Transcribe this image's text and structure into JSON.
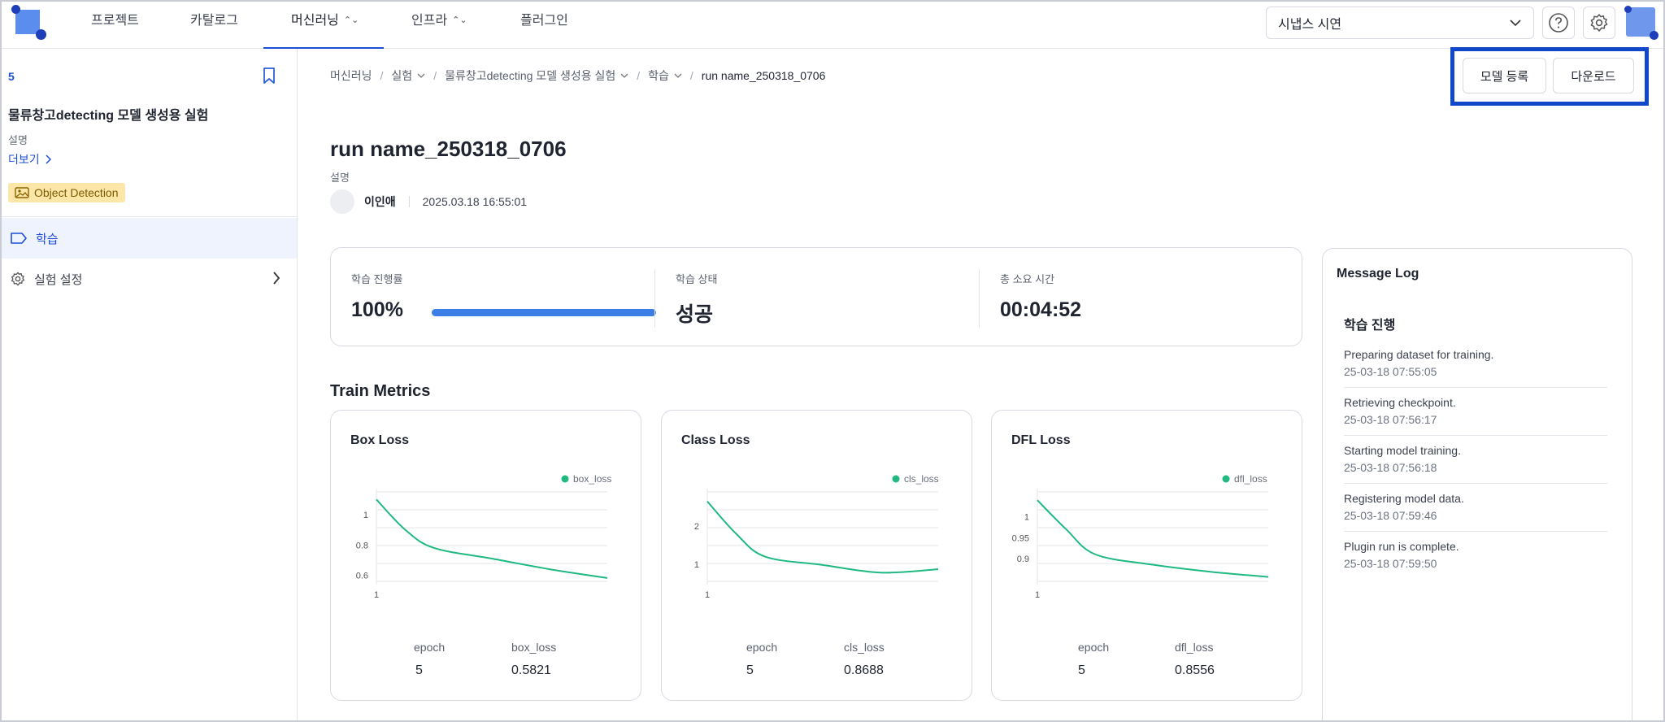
{
  "nav": {
    "items": [
      {
        "label": "프로젝트",
        "has_chevron": false,
        "active": false
      },
      {
        "label": "카탈로그",
        "has_chevron": false,
        "active": false
      },
      {
        "label": "머신러닝",
        "has_chevron": true,
        "active": true
      },
      {
        "label": "인프라",
        "has_chevron": true,
        "active": false
      },
      {
        "label": "플러그인",
        "has_chevron": false,
        "active": false
      }
    ],
    "workspace": "시냅스 시연",
    "accent_color": "#1d4ed8"
  },
  "sidebar": {
    "count": "5",
    "experiment_title": "물류창고detecting 모델 생성용 실험",
    "description_label": "설명",
    "more_label": "더보기",
    "tag": "Object Detection",
    "menu": [
      {
        "label": "학습",
        "icon": "tag-icon",
        "active": true
      },
      {
        "label": "실험 설정",
        "icon": "gear-icon",
        "active": false
      }
    ]
  },
  "breadcrumb": [
    {
      "label": "머신러닝",
      "dropdown": false
    },
    {
      "label": "실험",
      "dropdown": true
    },
    {
      "label": "물류창고detecting 모델 생성용 실험",
      "dropdown": true
    },
    {
      "label": "학습",
      "dropdown": true
    },
    {
      "label": "run name_250318_0706",
      "dropdown": false
    }
  ],
  "actions": {
    "register_model": "모델 등록",
    "download": "다운로드"
  },
  "run": {
    "title": "run name_250318_0706",
    "description_label": "설명",
    "user": "이인애",
    "date": "2025.03.18 16:55:01"
  },
  "stats": {
    "progress_label": "학습 진행률",
    "progress_value": "100%",
    "progress_fraction": 1.0,
    "status_label": "학습 상태",
    "status_value": "성공",
    "duration_label": "총 소요 시간",
    "duration_value": "00:04:52"
  },
  "metrics_section_title": "Train Metrics",
  "metrics": [
    {
      "title": "Box Loss",
      "legend": "box_loss",
      "field1_label": "epoch",
      "field1_value": "5",
      "field2_label": "box_loss",
      "field2_value": "0.5821"
    },
    {
      "title": "Class Loss",
      "legend": "cls_loss",
      "field1_label": "epoch",
      "field1_value": "5",
      "field2_label": "cls_loss",
      "field2_value": "0.8688"
    },
    {
      "title": "DFL Loss",
      "legend": "dfl_loss",
      "field1_label": "epoch",
      "field1_value": "5",
      "field2_label": "dfl_loss",
      "field2_value": "0.8556"
    }
  ],
  "chart_data": [
    {
      "type": "line",
      "series": [
        {
          "name": "box_loss",
          "x": [
            1,
            1.5,
            2,
            3,
            4,
            5
          ],
          "y": [
            1.1,
            0.9,
            0.78,
            0.71,
            0.64,
            0.582
          ]
        }
      ],
      "yticks": [
        0.6,
        0.8,
        1
      ],
      "xticks": [
        1
      ],
      "ylim": [
        0.56,
        1.15
      ],
      "color": "#1fb981"
    },
    {
      "type": "line",
      "series": [
        {
          "name": "cls_loss",
          "x": [
            1,
            1.5,
            2,
            3,
            4,
            5
          ],
          "y": [
            2.65,
            1.8,
            1.2,
            0.98,
            0.78,
            0.869
          ]
        }
      ],
      "yticks": [
        1,
        2
      ],
      "xticks": [
        1
      ],
      "ylim": [
        0.55,
        2.9
      ],
      "color": "#1fb981"
    },
    {
      "type": "line",
      "series": [
        {
          "name": "dfl_loss",
          "x": [
            1,
            1.5,
            2,
            3,
            4,
            5
          ],
          "y": [
            1.04,
            0.97,
            0.91,
            0.885,
            0.868,
            0.8556
          ]
        }
      ],
      "yticks": [
        0.9,
        0.95,
        1
      ],
      "xticks": [
        1
      ],
      "ylim": [
        0.845,
        1.06
      ],
      "color": "#1fb981"
    }
  ],
  "message_log": {
    "title": "Message Log",
    "section": "학습 진행",
    "items": [
      {
        "message": "Preparing dataset for training.",
        "time": "25-03-18 07:55:05"
      },
      {
        "message": "Retrieving checkpoint.",
        "time": "25-03-18 07:56:17"
      },
      {
        "message": "Starting model training.",
        "time": "25-03-18 07:56:18"
      },
      {
        "message": "Registering model data.",
        "time": "25-03-18 07:59:46"
      },
      {
        "message": "Plugin run is complete.",
        "time": "25-03-18 07:59:50"
      }
    ]
  }
}
